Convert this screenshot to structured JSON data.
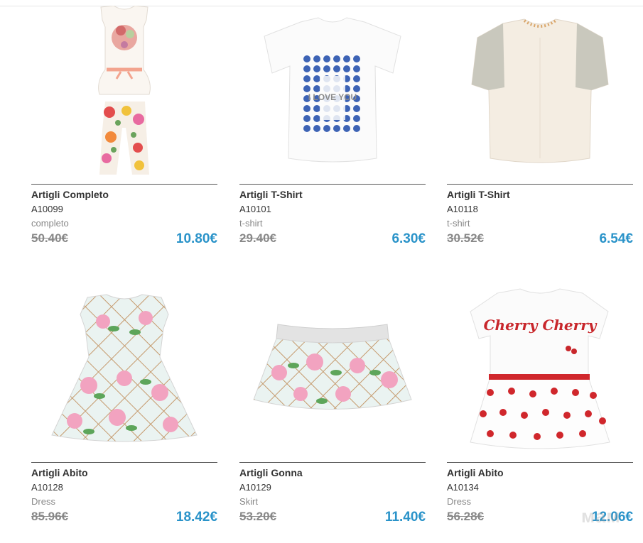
{
  "products": [
    {
      "title": "Artigli Completo",
      "code": "A10099",
      "category": "completo",
      "old_price": "50.40€",
      "new_price": "10.80€"
    },
    {
      "title": "Artigli T-Shirt",
      "code": "A10101",
      "category": "t-shirt",
      "old_price": "29.40€",
      "new_price": "6.30€"
    },
    {
      "title": "Artigli T-Shirt",
      "code": "A10118",
      "category": "t-shirt",
      "old_price": "30.52€",
      "new_price": "6.54€"
    },
    {
      "title": "Artigli Abito",
      "code": "A10128",
      "category": "Dress",
      "old_price": "85.96€",
      "new_price": "18.42€"
    },
    {
      "title": "Artigli Gonna",
      "code": "A10129",
      "category": "Skirt",
      "old_price": "53.20€",
      "new_price": "11.40€"
    },
    {
      "title": "Artigli Abito",
      "code": "A10134",
      "category": "Dress",
      "old_price": "56.28€",
      "new_price": "12.06€"
    }
  ],
  "tshirt_print": "I LOVE YOU",
  "dress_print": "Cherry Cherry",
  "watermark": "мам",
  "colors": {
    "price_accent": "#2a93c9",
    "old_price": "#888888"
  }
}
